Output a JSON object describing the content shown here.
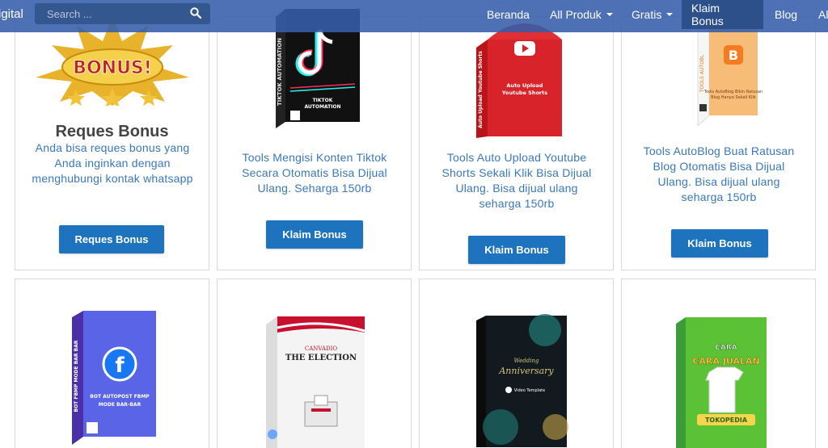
{
  "navbar": {
    "brand": "igital",
    "search_placeholder": "Search ...",
    "items": [
      {
        "label": "Beranda"
      },
      {
        "label": "All Produk"
      },
      {
        "label": "Gratis"
      },
      {
        "label": "Klaim Bonus"
      },
      {
        "label": "Blog"
      },
      {
        "label": "Al"
      }
    ]
  },
  "cards": [
    {
      "badge": "BONUS!",
      "title": "Reques Bonus",
      "desc": "Anda bisa reques bonus yang Anda inginkan dengan menghubungi kontak whatsapp",
      "button": "Reques Bonus"
    },
    {
      "box_label": "TIKTOK AUTOMATION",
      "box_side": "TIKTOK AUTOMATION",
      "desc": "Tools Mengisi Konten Tiktok Secara Otomatis Bisa Dijual Ulang. Seharga 150rb",
      "button": "Klaim Bonus"
    },
    {
      "box_label": "Auto Upload Youtube Shorts",
      "box_side": "Auto Upload Youtube Shorts",
      "desc": "Tools Auto Upload Youtube Shorts Sekali Klik Bisa Dijual Ulang. Bisa dijual ulang seharga 150rb",
      "button": "Klaim Bonus"
    },
    {
      "box_label": "Tools AutoBlog Bikin Ratusan Blog Hanya Sekali Klik",
      "box_side": "TOOLS AUTOBL",
      "desc": "Tools AutoBlog Buat Ratusan Blog Otomatis Bisa Dijual Ulang. Bisa dijual ulang seharga 150rb",
      "button": "Klaim Bonus"
    },
    {
      "box_label": "BOT AUTOPOST FBMP MODE BAR-BAR",
      "box_side": "BOT FBMP MODE BAR BAR"
    },
    {
      "box_label": "THE ELECTION",
      "box_sub": "CANVADIO"
    },
    {
      "box_label": "Wedding Anniversary",
      "box_sub": "Video Template"
    },
    {
      "box_label": "CARA JUALAN",
      "box_sub": "TOKOPEDIA"
    }
  ],
  "colors": {
    "nav_bg": "#345daa",
    "button_bg": "#1e73be",
    "link_text": "#3a78b8"
  }
}
